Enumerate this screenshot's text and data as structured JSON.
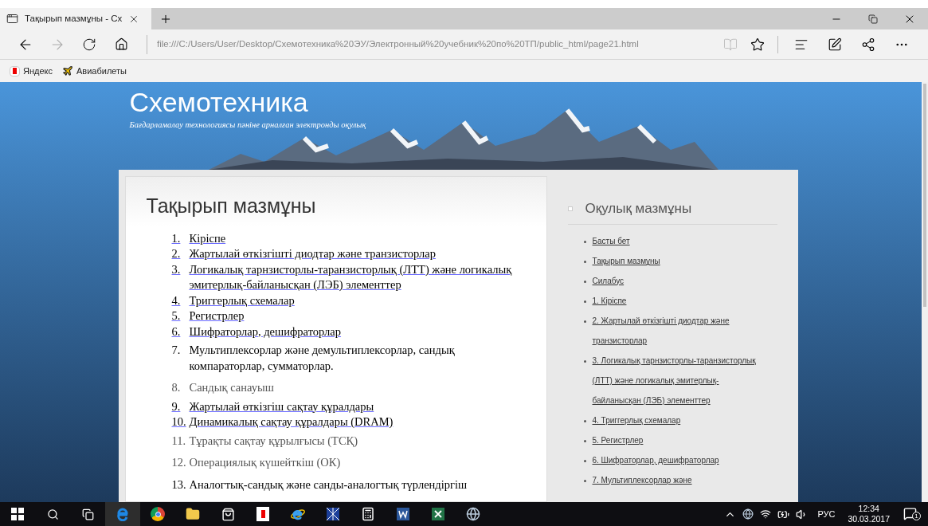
{
  "browser": {
    "tab_title": "Тақырып мазмұны - Сх",
    "address": "file:///C:/Users/User/Desktop/Схемотехника%20ЭУ/Электронный%20учебник%20по%20ТП/public_html/page21.html",
    "bookmarks": [
      {
        "label": "Яндекс",
        "kind": "yandex"
      },
      {
        "label": "Авиабилеты",
        "kind": "plane"
      }
    ]
  },
  "site": {
    "title": "Схемотехника",
    "subtitle": "Бағдарламалау технологиясы пәніне арналған электронды оқулық"
  },
  "main": {
    "heading": "Тақырып мазмұны",
    "items": [
      {
        "number": "1.",
        "text": "Кіріспе",
        "kind": "link"
      },
      {
        "number": "2.",
        "text": "Жартылай өткізгішті диодтар және транзисторлар",
        "kind": "link"
      },
      {
        "number": "3.",
        "text": "Логикалық тарнзисторлы-таранзисторлық (ЛТТ) және логикалық эмитерлық-байланысқан (ЛЭБ) элементтер",
        "kind": "link"
      },
      {
        "number": "4.",
        "text": "Триггерлық схемалар",
        "kind": "link"
      },
      {
        "number": "5.",
        "text": "Регистрлер",
        "kind": "link"
      },
      {
        "number": "6.",
        "text": "Шифраторлар, дешифраторлар",
        "kind": "link"
      },
      {
        "number": "7.",
        "text": "Мультиплексорлар және демультиплексорлар, сандық компараторлар, сумматорлар.",
        "kind": "plain"
      },
      {
        "number": "8.",
        "text": "Сандық санауыш",
        "kind": "muted"
      },
      {
        "number": "9.",
        "text": "Жартылай өткізгіш сақтау құралдары",
        "kind": "link"
      },
      {
        "number": "10.",
        "text": "Динамикалық сақтау құралдары (DRAM)",
        "kind": "link"
      },
      {
        "number": "11.",
        "text": "Тұрақты сақтау құрылғысы (ТСҚ)",
        "kind": "muted"
      },
      {
        "number": "12.",
        "text": "Операциялық күшейткіш (ОК)",
        "kind": "muted"
      },
      {
        "number": "13.",
        "text": "Аналогтық-сандық және санды-аналогтық түрлендіргіш",
        "kind": "plain"
      }
    ]
  },
  "sidebar": {
    "heading": "Оқулық мазмұны",
    "links": [
      "Басты бет",
      "Тақырып мазмұны",
      "Силабус",
      "1. Кіріспе",
      "2. Жартылай өткізгішті диодтар және транзисторлар",
      "3. Логикалық тарнзисторлы-таранзисторлық (ЛТТ) және логикалық эмитерлық-байланысқан (ЛЭБ) элементтер",
      "4. Триггерлық схемалар",
      "5. Регистрлер",
      "6. Шифраторлар, дешифраторлар",
      "7. Мультиплексорлар және"
    ]
  },
  "taskbar": {
    "language": "РУС",
    "time": "12:34",
    "date": "30.03.2017",
    "notifications": "1"
  }
}
